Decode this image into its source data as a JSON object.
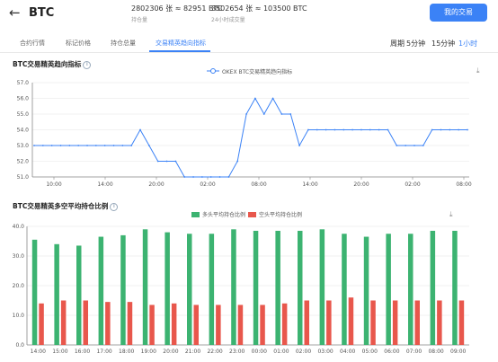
{
  "header": {
    "title": "BTC",
    "stats": [
      {
        "value": "2802306 张 ≈ 82951 BTC",
        "label": "持仓量"
      },
      {
        "value": "3502654 张 ≈ 103500 BTC",
        "label": "24小时成交量"
      }
    ],
    "cta_label": "我的交易"
  },
  "tabs": [
    {
      "label": "合约行情",
      "active": false
    },
    {
      "label": "标记价格",
      "active": false
    },
    {
      "label": "持仓总量",
      "active": false
    },
    {
      "label": "交易精英趋向指标",
      "active": true
    }
  ],
  "periods": {
    "label": "周期",
    "options": [
      {
        "label": "5分钟",
        "active": false
      },
      {
        "label": "15分钟",
        "active": false
      },
      {
        "label": "1小时",
        "active": true
      }
    ]
  },
  "colors": {
    "accent": "#3b82f6",
    "long": "#3cb371",
    "short": "#e8574c"
  },
  "icons": {
    "back": "arrow-left-icon",
    "info": "info-icon",
    "download": "download-icon"
  },
  "chart_data": [
    {
      "type": "line",
      "title": "BTC交易精英趋向指标",
      "series": [
        {
          "name": "OKEX BTC交易精英趋向指标",
          "values": [
            53,
            53,
            53,
            53,
            53,
            53,
            53,
            53,
            53,
            53,
            53,
            53,
            54,
            53,
            52,
            52,
            52,
            51,
            51,
            51,
            51,
            51,
            51,
            52,
            55,
            56,
            55,
            56,
            55,
            55,
            53,
            54,
            54,
            54,
            54,
            54,
            54,
            54,
            54,
            54,
            54,
            53,
            53,
            53,
            53,
            54,
            54,
            54,
            54,
            54
          ]
        }
      ],
      "x_ticks": [
        "10:00",
        "14:00",
        "20:00",
        "02:00",
        "08:00",
        "14:00",
        "20:00",
        "02:00",
        "08:00"
      ],
      "y_ticks": [
        "51.0",
        "52.0",
        "53.0",
        "54.0",
        "55.0",
        "56.0",
        "57.0"
      ],
      "ylim": [
        51,
        57
      ]
    },
    {
      "type": "bar",
      "title": "BTC交易精英多空平均持仓比例",
      "categories": [
        "14:00",
        "15:00",
        "16:00",
        "17:00",
        "18:00",
        "19:00",
        "20:00",
        "21:00",
        "22:00",
        "23:00",
        "00:00",
        "01:00",
        "02:00",
        "03:00",
        "04:00",
        "05:00",
        "06:00",
        "07:00",
        "08:00",
        "09:00"
      ],
      "series": [
        {
          "name": "多头平均持仓比例",
          "values": [
            35.5,
            34,
            33.5,
            36.5,
            37,
            39,
            38,
            37.5,
            37.5,
            39,
            38.5,
            38.5,
            38.5,
            39,
            37.5,
            36.5,
            37.5,
            37.5,
            38.5,
            38.5
          ]
        },
        {
          "name": "空头平均持仓比例",
          "values": [
            14,
            15,
            15,
            14.5,
            14.5,
            13.5,
            14,
            13.5,
            13.5,
            13.5,
            13.5,
            14,
            15,
            15,
            16,
            15,
            15,
            15,
            15,
            15
          ]
        }
      ],
      "y_ticks": [
        "0.0",
        "10.0",
        "20.0",
        "30.0",
        "40.0"
      ],
      "ylim": [
        0,
        40
      ]
    }
  ]
}
